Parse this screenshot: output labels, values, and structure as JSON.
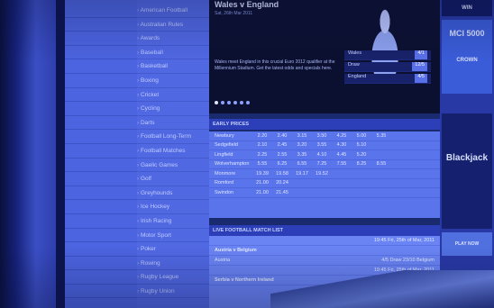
{
  "nav": {
    "items": [
      "American Football",
      "Australian Rules",
      "Awards",
      "Baseball",
      "Basketball",
      "Boxing",
      "Cricket",
      "Cycling",
      "Darts",
      "Football Long-Term",
      "Football Matches",
      "Gaelic Games",
      "Golf",
      "Greyhounds",
      "Ice Hockey",
      "Irish Racing",
      "Motor Sport",
      "Poker",
      "Rowing",
      "Rugby League",
      "Rugby Union"
    ]
  },
  "hero": {
    "title": "Wales v England",
    "subtitle": "Sat, 26th Mar 2011",
    "description": "Wales meet England in this crucial Euro 2012 qualifier at the Millennium Stadium. Get the latest odds and specials here.",
    "odds": [
      {
        "label": "Wales",
        "price": "4/1"
      },
      {
        "label": "Draw",
        "price": "12/5"
      },
      {
        "label": "England",
        "price": "4/5"
      }
    ]
  },
  "early_prices": {
    "title": "EARLY PRICES",
    "rows": [
      {
        "venue": "Newbury",
        "times": [
          "2.20",
          "2.40",
          "3.15",
          "3.50",
          "4.25",
          "5.00",
          "5.35"
        ]
      },
      {
        "venue": "Sedgefield",
        "times": [
          "2.10",
          "2.45",
          "3.20",
          "3.55",
          "4.30",
          "5.10",
          ""
        ]
      },
      {
        "venue": "Lingfield",
        "times": [
          "2.25",
          "2.55",
          "3.35",
          "4.10",
          "4.45",
          "5.20",
          ""
        ]
      },
      {
        "venue": "Wolverhampton",
        "times": [
          "5.55",
          "6.25",
          "6.55",
          "7.25",
          "7.55",
          "8.25",
          "8.55"
        ]
      },
      {
        "venue": "Monmore",
        "times": [
          "19.39",
          "19.58",
          "19.17",
          "19.52",
          "",
          "",
          ""
        ]
      },
      {
        "venue": "Romford",
        "times": [
          "21.00",
          "20.24",
          "",
          "",
          "",
          "",
          ""
        ]
      },
      {
        "venue": "Swindon",
        "times": [
          "21.00",
          "21.45",
          "",
          "",
          "",
          "",
          ""
        ]
      }
    ]
  },
  "live": {
    "title": "LIVE FOOTBALL MATCH LIST",
    "rows": [
      {
        "left": "",
        "right": "19:45 Fri, 25th of Mar, 2011",
        "match": false
      },
      {
        "left": "Austria v Belgium",
        "right": "",
        "match": true
      },
      {
        "left": "Austria",
        "right": "4/5   Draw   23/10   Belgium",
        "match": false
      },
      {
        "left": "",
        "right": "19:45 Fri, 25th of Mar, 2011",
        "match": false
      },
      {
        "left": "Serbia v Northern Ireland",
        "right": "",
        "match": true
      }
    ]
  },
  "promos": {
    "top": "WIN",
    "middle_big": "MCI 5000",
    "middle_small": "CROWN",
    "blackjack": "Blackjack",
    "bottom": "PLAY NOW"
  }
}
